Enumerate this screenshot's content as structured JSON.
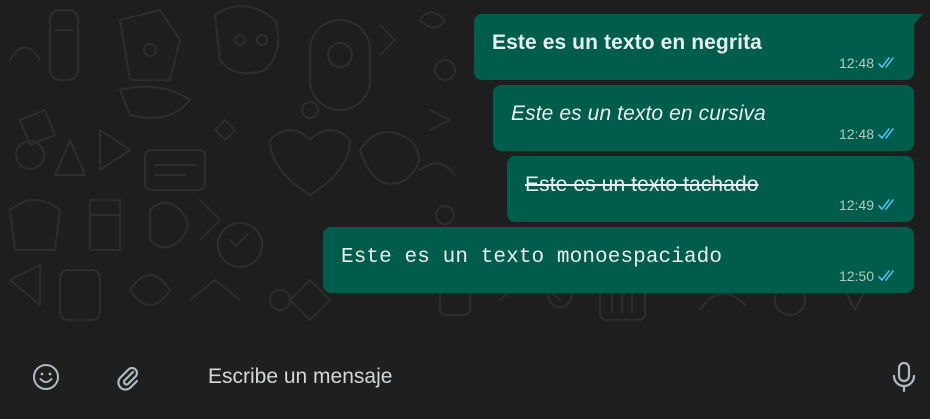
{
  "chat": {
    "messages": [
      {
        "text": "Este es un texto en negrita",
        "style": "bold",
        "time": "12:48"
      },
      {
        "text": "Este es un texto en cursiva",
        "style": "italic",
        "time": "12:48"
      },
      {
        "text": "Este es un texto tachado",
        "style": "strikethrough",
        "time": "12:49"
      },
      {
        "text": "Este es un texto monoespaciado",
        "style": "monospace",
        "time": "12:50"
      }
    ],
    "read_receipt_icon": "double-check-icon",
    "colors": {
      "bubble": "#005c4b",
      "background": "#1e1e1e",
      "receipt": "#53bdeb"
    }
  },
  "composer": {
    "placeholder": "Escribe un mensaje",
    "emoji_icon": "emoji-icon",
    "attach_icon": "paperclip-icon",
    "mic_icon": "microphone-icon"
  }
}
